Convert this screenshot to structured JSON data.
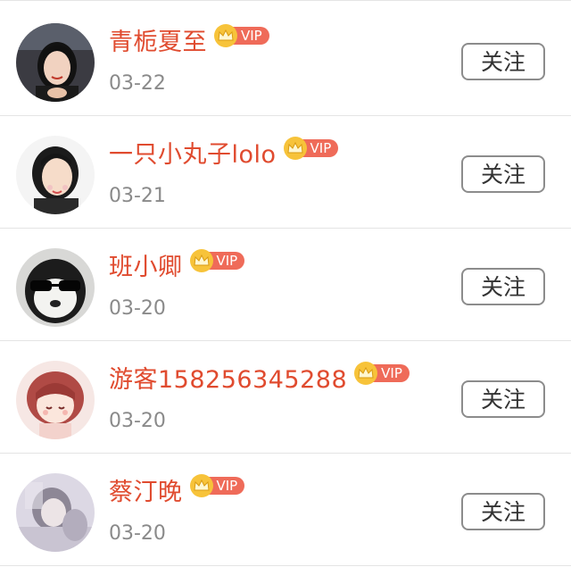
{
  "users": [
    {
      "name": "青栀夏至",
      "vip": "VIP",
      "date": "03-22",
      "follow_label": "关注",
      "avatar": "woman-portrait-avatar"
    },
    {
      "name": "一只小丸子lolo",
      "vip": "VIP",
      "date": "03-21",
      "follow_label": "关注",
      "avatar": "girl-selfie-avatar"
    },
    {
      "name": "班小卿",
      "vip": "VIP",
      "date": "03-20",
      "follow_label": "关注",
      "avatar": "panda-sunglasses-avatar"
    },
    {
      "name": "游客158256345288",
      "vip": "VIP",
      "date": "03-20",
      "follow_label": "关注",
      "avatar": "anime-girl-avatar"
    },
    {
      "name": "蔡汀晚",
      "vip": "VIP",
      "date": "03-20",
      "follow_label": "关注",
      "avatar": "blurred-photo-avatar"
    }
  ],
  "colors": {
    "name": "#e04b2f",
    "date": "#8a8a8a",
    "vip_badge": "#ef6b59",
    "crown": "#f7c33a",
    "button_border": "#8c8c8c"
  }
}
